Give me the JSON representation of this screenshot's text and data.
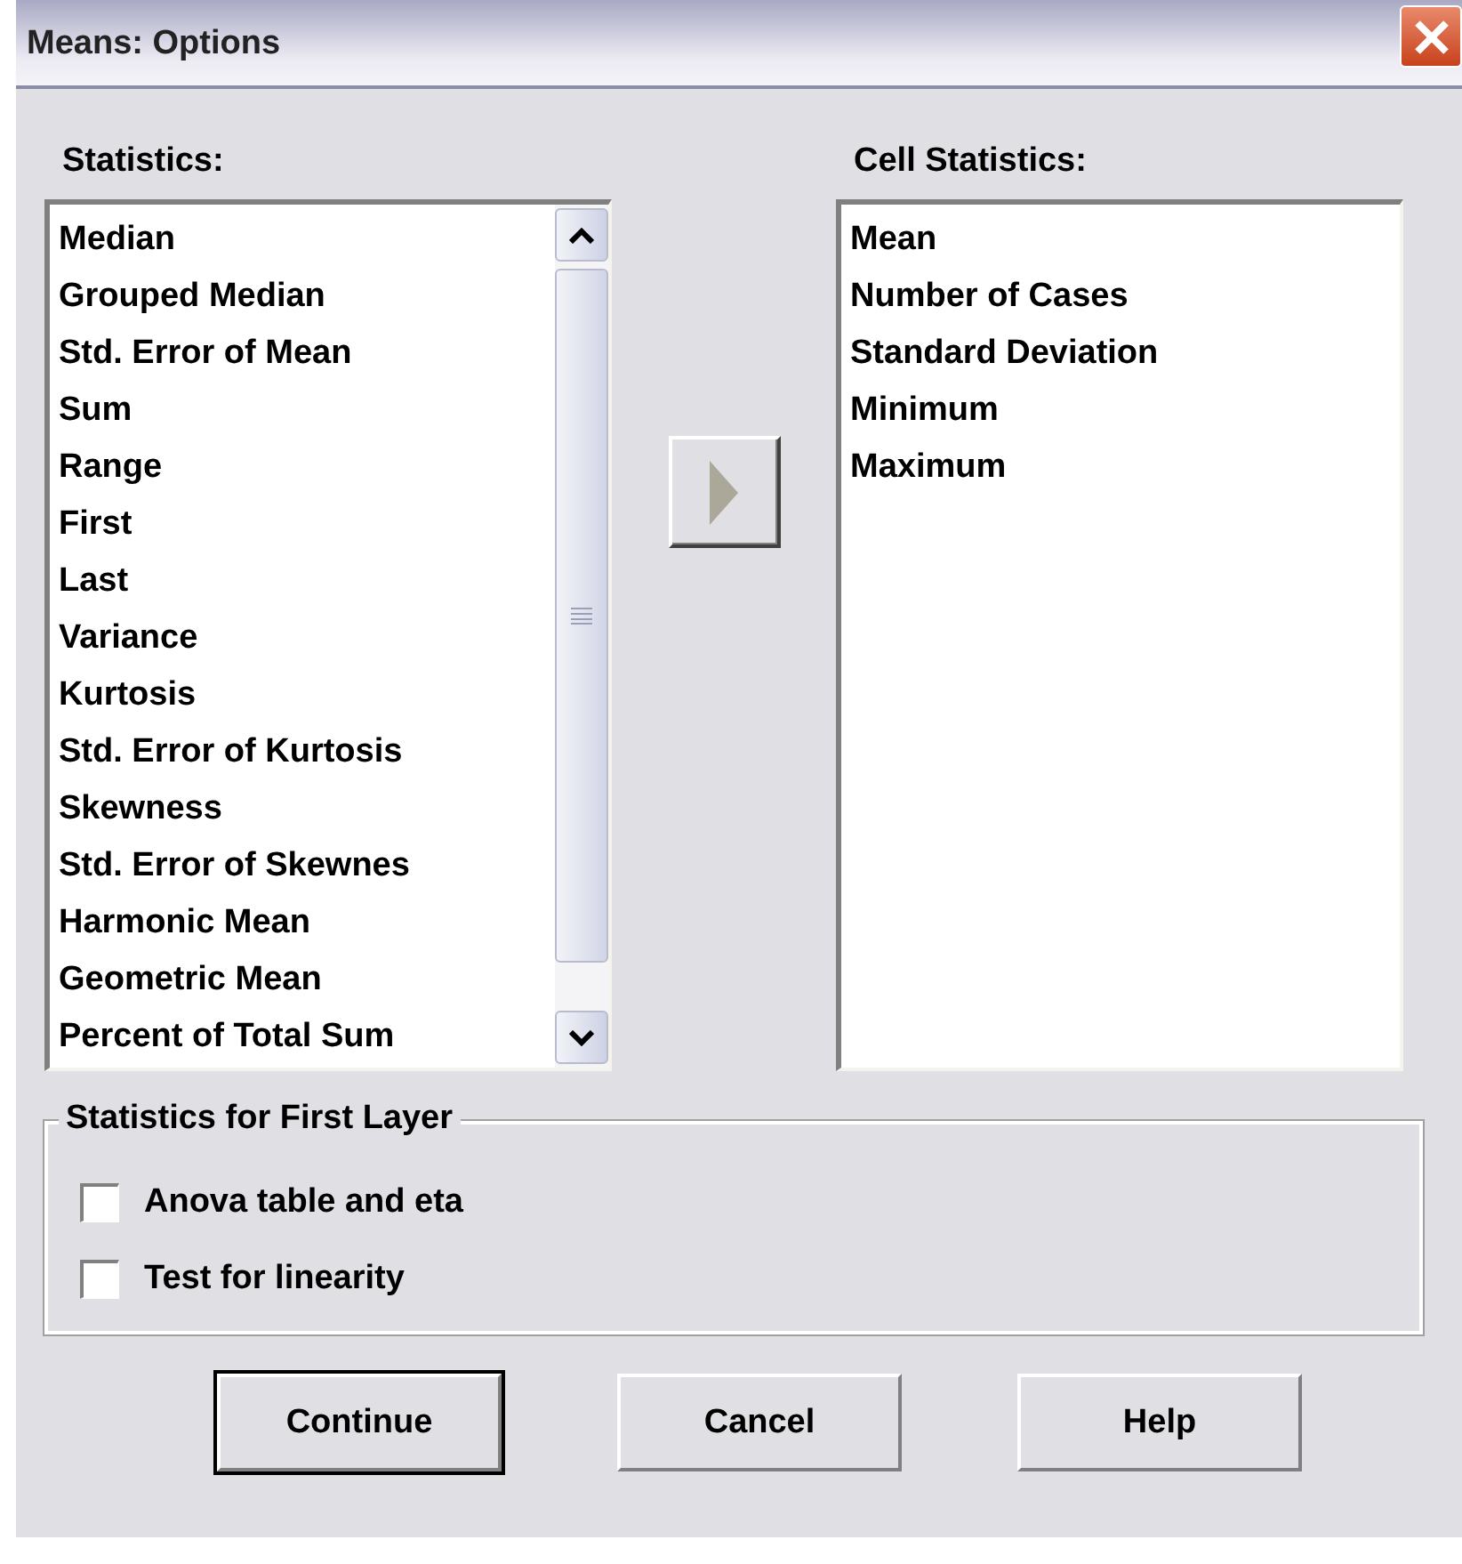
{
  "window": {
    "title": "Means: Options"
  },
  "statistics": {
    "label": "Statistics:",
    "items": [
      {
        "label": "Median",
        "selected": false
      },
      {
        "label": "Grouped Median",
        "selected": false
      },
      {
        "label": "Std. Error of Mean",
        "selected": false
      },
      {
        "label": "Sum",
        "selected": false
      },
      {
        "label": "Range",
        "selected": false
      },
      {
        "label": "First",
        "selected": false
      },
      {
        "label": "Last",
        "selected": false
      },
      {
        "label": "Variance",
        "selected": false
      },
      {
        "label": "Kurtosis",
        "selected": false
      },
      {
        "label": "Std. Error of Kurtosis",
        "selected": false
      },
      {
        "label": "Skewness",
        "selected": false
      },
      {
        "label": "Std. Error of Skewnes",
        "selected": false
      },
      {
        "label": "Harmonic Mean",
        "selected": false
      },
      {
        "label": "Geometric Mean",
        "selected": false
      },
      {
        "label": "Percent of Total Sum",
        "selected": false
      }
    ]
  },
  "cell_statistics": {
    "label": "Cell Statistics:",
    "items": [
      {
        "label": "Mean",
        "selected": false
      },
      {
        "label": "Number of Cases",
        "selected": false
      },
      {
        "label": "Standard Deviation",
        "selected": false
      },
      {
        "label": "Minimum",
        "selected": false
      },
      {
        "label": "Maximum",
        "selected": false
      }
    ]
  },
  "first_layer": {
    "title": "Statistics for First Layer",
    "options": [
      {
        "label": "Anova table and eta",
        "checked": false
      },
      {
        "label": "Test for linearity",
        "checked": false
      }
    ]
  },
  "buttons": [
    {
      "label": "Continue",
      "default": true
    },
    {
      "label": "Cancel",
      "default": false
    },
    {
      "label": "Help",
      "default": false
    }
  ]
}
